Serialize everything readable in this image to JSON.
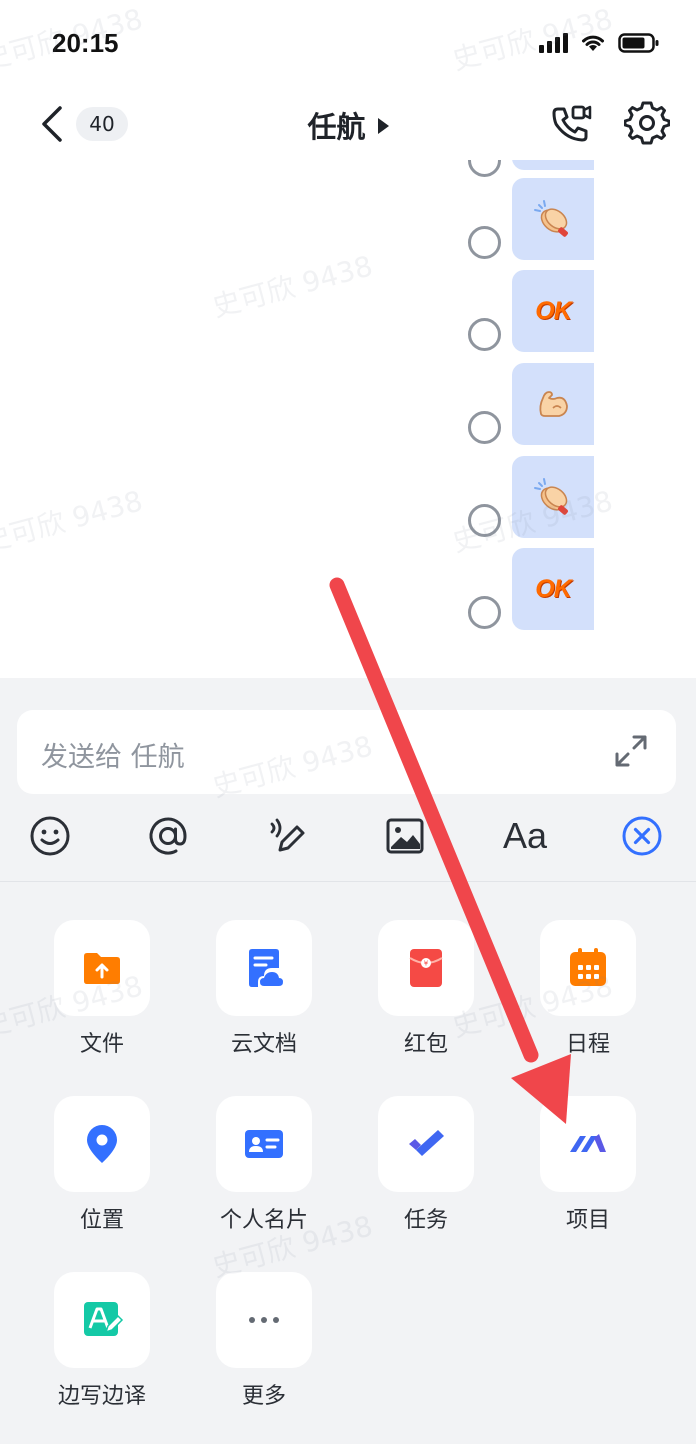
{
  "status_bar": {
    "time": "20:15"
  },
  "header": {
    "unread_count": "40",
    "title": "任航"
  },
  "messages": [
    {
      "sticker": "clapping-hands"
    },
    {
      "sticker": "ok",
      "text": "OK"
    },
    {
      "sticker": "flexed-biceps"
    },
    {
      "sticker": "clapping-hands"
    },
    {
      "sticker": "ok",
      "text": "OK"
    }
  ],
  "composer": {
    "placeholder": "发送给 任航",
    "toolbar": {
      "font_label": "Aa"
    }
  },
  "actions": {
    "files": "文件",
    "cloud_docs": "云文档",
    "red_packet": "红包",
    "calendar": "日程",
    "location": "位置",
    "contact_card": "个人名片",
    "task": "任务",
    "project": "项目",
    "write_translate": "边写边译",
    "more": "更多"
  },
  "watermark": "史可欣 9438",
  "colors": {
    "accent": "#3370ff",
    "orange": "#ff7d00",
    "red": "#f54a45",
    "green": "#14c9a6",
    "arrow": "#f0464b",
    "bubble": "#d3e0fb"
  }
}
